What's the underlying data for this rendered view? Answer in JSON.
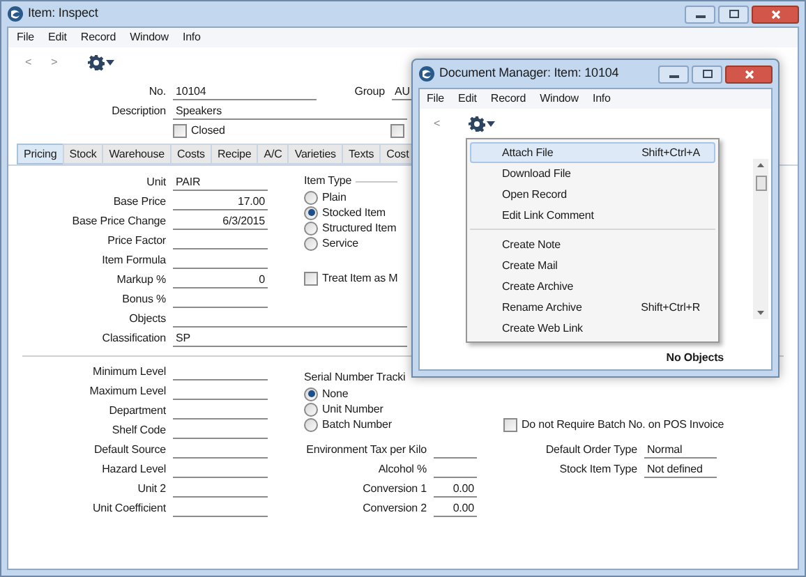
{
  "window": {
    "title": "Item: Inspect"
  },
  "menu": [
    "File",
    "Edit",
    "Record",
    "Window",
    "Info"
  ],
  "toolbar": {
    "back": "<",
    "forward": ">"
  },
  "header": {
    "no": {
      "label": "No.",
      "value": "10104"
    },
    "group": {
      "label": "Group",
      "value": "AU"
    },
    "description": {
      "label": "Description",
      "value": "Speakers"
    },
    "closed": {
      "label": "Closed",
      "checked": false
    },
    "right_checkbox": {
      "checked": false
    }
  },
  "tabs": [
    {
      "label": "Pricing",
      "selected": true
    },
    {
      "label": "Stock",
      "selected": false
    },
    {
      "label": "Warehouse",
      "selected": false
    },
    {
      "label": "Costs",
      "selected": false
    },
    {
      "label": "Recipe",
      "selected": false
    },
    {
      "label": "A/C",
      "selected": false
    },
    {
      "label": "Varieties",
      "selected": false
    },
    {
      "label": "Texts",
      "selected": false
    },
    {
      "label": "Cost",
      "selected": false
    }
  ],
  "pricing_fields": [
    {
      "label": "Unit",
      "value": "PAIR",
      "kind": "text"
    },
    {
      "label": "Base Price",
      "value": "17.00",
      "kind": "number"
    },
    {
      "label": "Base Price Change",
      "value": "6/3/2015",
      "kind": "number"
    },
    {
      "label": "Price Factor",
      "kind": "text"
    },
    {
      "label": "Item Formula",
      "kind": "text"
    },
    {
      "label": "Markup %",
      "value": "0",
      "kind": "number"
    },
    {
      "label": "Bonus %",
      "kind": "text"
    },
    {
      "label": "Objects",
      "kind": "wide"
    },
    {
      "label": "Classification",
      "value": "SP",
      "kind": "wide"
    }
  ],
  "item_type": {
    "title": "Item Type",
    "options": [
      {
        "label": "Plain",
        "selected": false
      },
      {
        "label": "Stocked Item",
        "selected": true
      },
      {
        "label": "Structured Item",
        "selected": false
      },
      {
        "label": "Service",
        "selected": false
      }
    ]
  },
  "treat_item": {
    "label": "Treat Item as M",
    "checked": false
  },
  "stock_fields": [
    {
      "label": "Minimum Level"
    },
    {
      "label": "Maximum Level"
    },
    {
      "label": "Department"
    },
    {
      "label": "Shelf Code"
    },
    {
      "label": "Default Source"
    },
    {
      "label": "Hazard Level"
    },
    {
      "label": "Unit 2"
    },
    {
      "label": "Unit Coefficient"
    }
  ],
  "serial_tracking": {
    "title": "Serial Number Tracki",
    "options": [
      {
        "label": "None",
        "selected": true
      },
      {
        "label": "Unit Number",
        "selected": false
      },
      {
        "label": "Batch Number",
        "selected": false
      }
    ]
  },
  "middle_fields": [
    {
      "label": "Environment Tax per Kilo"
    },
    {
      "label": "Alcohol %"
    },
    {
      "label": "Conversion 1",
      "value": "0.00"
    },
    {
      "label": "Conversion 2",
      "value": "0.00"
    }
  ],
  "batch_checkbox": {
    "label": "Do not Require Batch No. on POS Invoice",
    "checked": false
  },
  "right_fields": [
    {
      "label": "Default Order Type",
      "value": "Normal"
    },
    {
      "label": "Stock Item Type",
      "value": "Not defined"
    }
  ],
  "document_manager": {
    "title": "Document Manager: Item: 10104",
    "menu": [
      "File",
      "Edit",
      "Record",
      "Window",
      "Info"
    ],
    "back": "<",
    "status": "No Objects",
    "menu_groups": [
      [
        {
          "label": "Attach File",
          "shortcut": "Shift+Ctrl+A",
          "selected": true
        },
        {
          "label": "Download File",
          "selected": false
        },
        {
          "label": "Open Record",
          "selected": false
        },
        {
          "label": "Edit Link Comment",
          "selected": false
        }
      ],
      [
        {
          "label": "Create Note",
          "selected": false
        },
        {
          "label": "Create Mail",
          "selected": false
        },
        {
          "label": "Create Archive",
          "selected": false
        },
        {
          "label": "Rename Archive",
          "shortcut": "Shift+Ctrl+R",
          "selected": false
        },
        {
          "label": "Create Web Link",
          "selected": false
        }
      ]
    ]
  }
}
